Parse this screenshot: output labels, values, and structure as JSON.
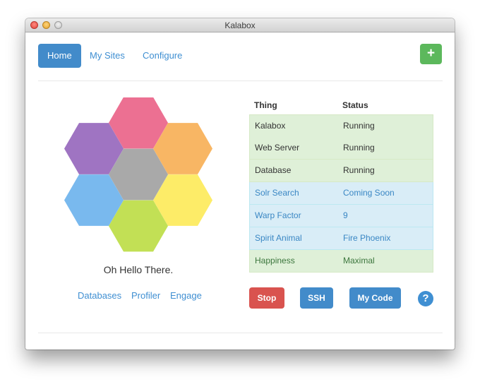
{
  "window": {
    "title": "Kalabox"
  },
  "nav": {
    "tabs": [
      {
        "label": "Home"
      },
      {
        "label": "My Sites"
      },
      {
        "label": "Configure"
      }
    ],
    "add_label": "+"
  },
  "colors": {
    "primary": "#428bca",
    "success": "#5cb85c",
    "danger": "#d9534f",
    "hex_colors": [
      "#e8507a",
      "#f7a642",
      "#fde847",
      "#b5d930",
      "#5ca9ea",
      "#8a56b4",
      "#9a9a9a"
    ]
  },
  "greeting": "Oh Hello There.",
  "links": [
    {
      "label": "Databases"
    },
    {
      "label": "Profiler"
    },
    {
      "label": "Engage"
    }
  ],
  "status_table": {
    "headers": [
      "Thing",
      "Status"
    ],
    "rows": [
      {
        "thing": "Kalabox",
        "status": "Running",
        "variant": "success"
      },
      {
        "thing": "Web Server",
        "status": "Running",
        "variant": "success"
      },
      {
        "thing": "Database",
        "status": "Running",
        "variant": "success"
      },
      {
        "thing": "Solr Search",
        "status": "Coming Soon",
        "variant": "info"
      },
      {
        "thing": "Warp Factor",
        "status": "9",
        "variant": "info"
      },
      {
        "thing": "Spirit Animal",
        "status": "Fire Phoenix",
        "variant": "info"
      },
      {
        "thing": "Happiness",
        "status": "Maximal",
        "variant": "success"
      }
    ]
  },
  "actions": {
    "stop": "Stop",
    "ssh": "SSH",
    "my_code": "My Code",
    "help": "?"
  }
}
